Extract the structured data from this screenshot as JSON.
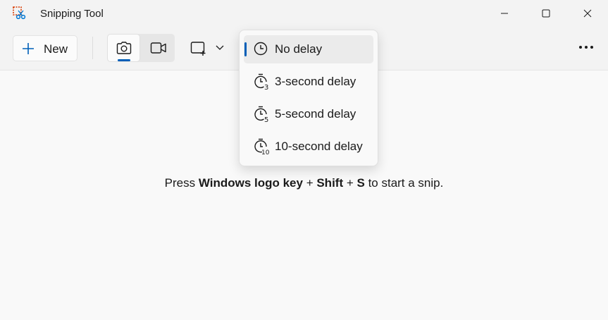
{
  "app": {
    "title": "Snipping Tool",
    "icon": "snipping-tool-icon"
  },
  "window_controls": [
    "minimize-icon",
    "maximize-icon",
    "close-icon"
  ],
  "toolbar": {
    "new_label": "New",
    "modes": [
      {
        "name": "screenshot-mode",
        "icon": "camera-icon",
        "selected": true
      },
      {
        "name": "video-mode",
        "icon": "video-camera-icon",
        "selected": false
      }
    ],
    "snip_shape_icon": "rectangle-snip-icon",
    "more_icon": "more-options-icon"
  },
  "delay_menu": {
    "items": [
      {
        "label": "No delay",
        "icon": "clock-icon",
        "selected": true
      },
      {
        "label": "3-second delay",
        "icon": "timer-3-icon",
        "selected": false
      },
      {
        "label": "5-second delay",
        "icon": "timer-5-icon",
        "selected": false
      },
      {
        "label": "10-second delay",
        "icon": "timer-10-icon",
        "selected": false
      }
    ]
  },
  "hint": {
    "prefix": "Press ",
    "key1": "Windows logo key",
    "plus1": " + ",
    "key2": "Shift",
    "plus2": " + ",
    "key3": "S",
    "suffix": " to start a snip."
  },
  "colors": {
    "accent": "#005fb8",
    "background": "#f3f3f3",
    "canvas": "#f9f9f9"
  }
}
